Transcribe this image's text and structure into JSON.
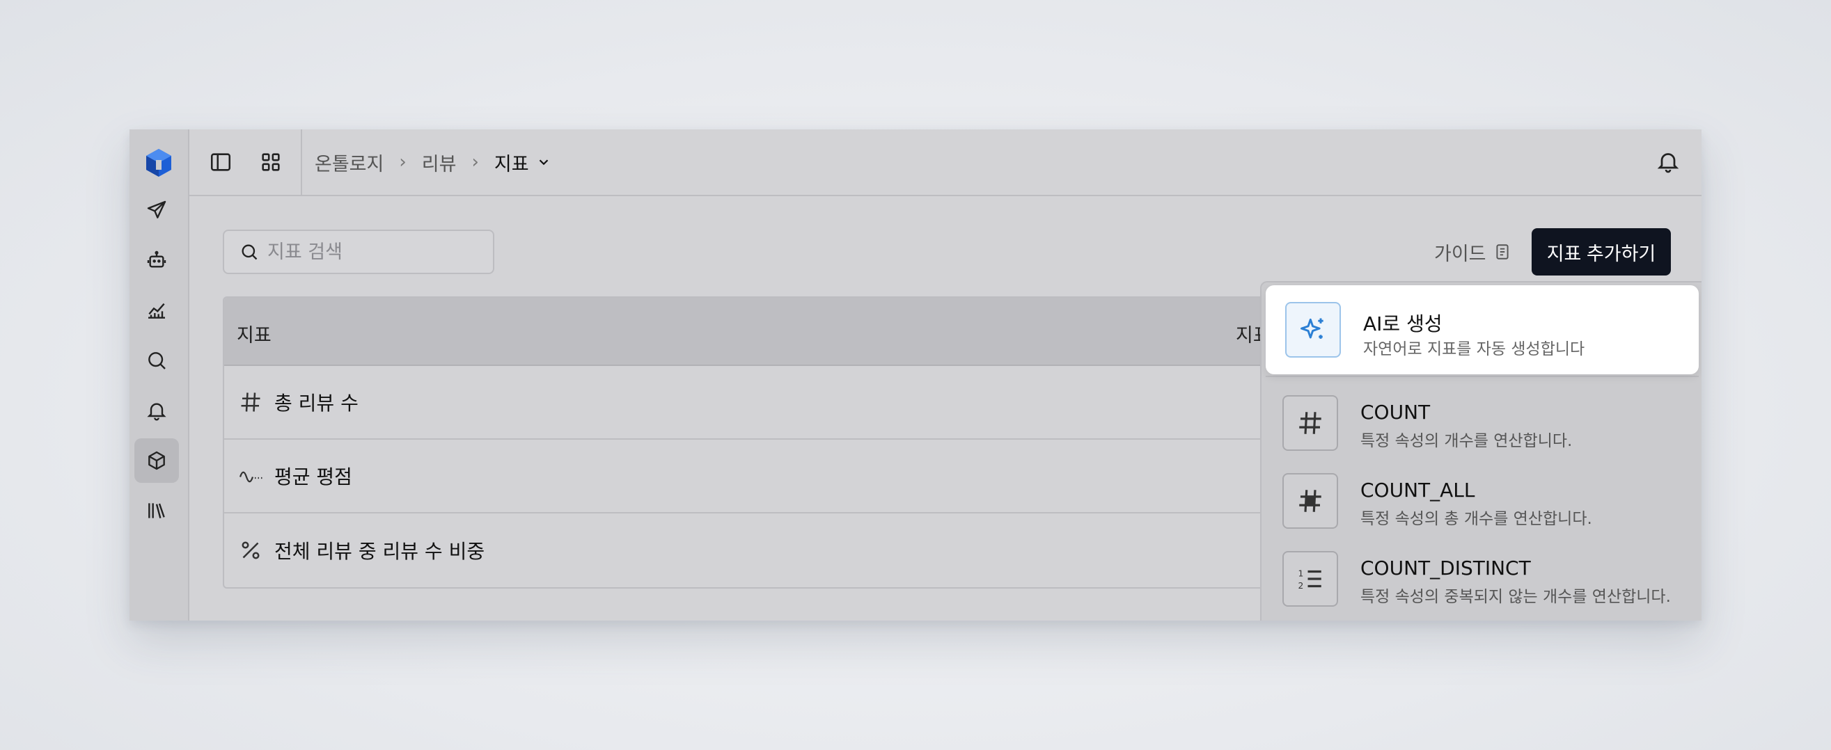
{
  "breadcrumb": {
    "items": [
      "온톨로지",
      "리뷰"
    ],
    "current": "지표"
  },
  "toolbar": {
    "search_placeholder": "지표 검색",
    "guide_label": "가이드",
    "add_label": "지표 추가하기"
  },
  "table": {
    "headers": [
      "지표",
      "지표"
    ],
    "rows": [
      {
        "icon": "hash-icon",
        "label": "총 리뷰 수"
      },
      {
        "icon": "wave-icon",
        "label": "평균 평점"
      },
      {
        "icon": "percent-icon",
        "label": "전체 리뷰 중 리뷰 수 비중"
      }
    ]
  },
  "menu": {
    "ai": {
      "title": "AI로 생성",
      "desc": "자연어로 지표를 자동 생성합니다",
      "icon": "sparkles-icon"
    },
    "items": [
      {
        "title": "COUNT",
        "desc": "특정 속성의 개수를 연산합니다.",
        "icon": "hash-icon"
      },
      {
        "title": "COUNT_ALL",
        "desc": "특정 속성의 총 개수를 연산합니다.",
        "icon": "hash-filled-icon"
      },
      {
        "title": "COUNT_DISTINCT",
        "desc": "특정 속성의 중복되지 않는 개수를 연산합니다.",
        "icon": "numbered-list-icon"
      }
    ]
  },
  "colors": {
    "accent": "#2b7fd4",
    "primary_button": "#0f1420",
    "logo": "#1d5fd6"
  }
}
